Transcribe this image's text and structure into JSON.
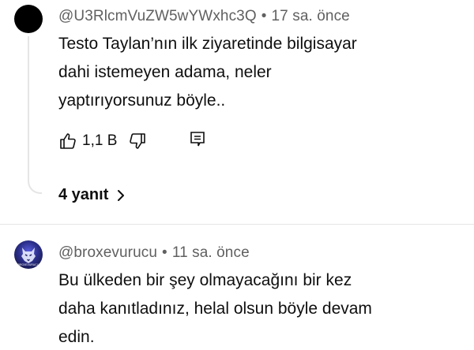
{
  "comments": [
    {
      "author": "@U3RlcmVuZW5wYWxhc3Q",
      "time": "17 sa. önce",
      "text_lines": [
        "Testo Taylan’nın ilk ziyaretinde bilgisayar",
        "dahi istemeyen adama, neler",
        "yaptırıyorsunuz böyle.."
      ],
      "like_count": "1,1 B",
      "replies_label": "4 yanıt",
      "icons": {
        "avatar": "avatar-black",
        "like": "thumbs-up-icon",
        "dislike": "thumbs-down-icon",
        "reply": "reply-icon",
        "expand": "chevron-right-icon"
      }
    },
    {
      "author": "@broxevurucu",
      "time": "11 sa. önce",
      "text_lines": [
        "Bu ülkeden bir şey olmayacağını bir kez",
        "daha kanıtladınız, helal olsun böyle devam",
        "edin."
      ],
      "avatar_logo_text": "BROXEVURUCU",
      "icons": {
        "avatar": "avatar-wolf-logo"
      }
    }
  ],
  "separator": "•",
  "colors": {
    "text": "#0f0f0f",
    "meta": "#606060",
    "thread_line": "#e5e5e5"
  }
}
